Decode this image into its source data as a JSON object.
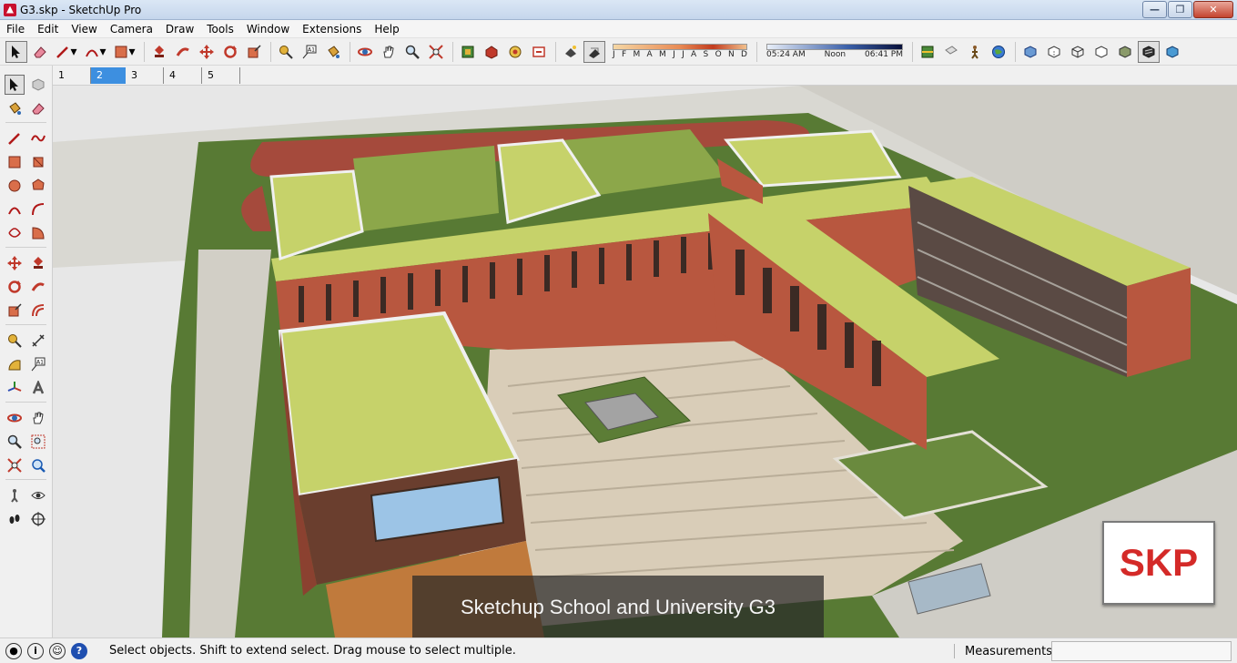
{
  "window": {
    "title": "G3.skp - SketchUp Pro"
  },
  "menu": [
    "File",
    "Edit",
    "View",
    "Camera",
    "Draw",
    "Tools",
    "Window",
    "Extensions",
    "Help"
  ],
  "shadow": {
    "months": [
      "J",
      "F",
      "M",
      "A",
      "M",
      "J",
      "J",
      "A",
      "S",
      "O",
      "N",
      "D"
    ],
    "time_start": "05:24 AM",
    "time_mid": "Noon",
    "time_end": "06:41 PM"
  },
  "scenes": {
    "tabs": [
      "1",
      "2",
      "3",
      "4",
      "5"
    ],
    "active": "2"
  },
  "viewport": {
    "caption": "Sketchup School and University G3",
    "logo": "SKP",
    "sky_color": "#e9e9e9",
    "roof_color": "#c6d26a",
    "brick_color": "#b8573f",
    "grass_color": "#5f7f3a"
  },
  "status": {
    "message": "Select objects. Shift to extend select. Drag mouse to select multiple.",
    "measurements_label": "Measurements",
    "measurements_value": ""
  }
}
